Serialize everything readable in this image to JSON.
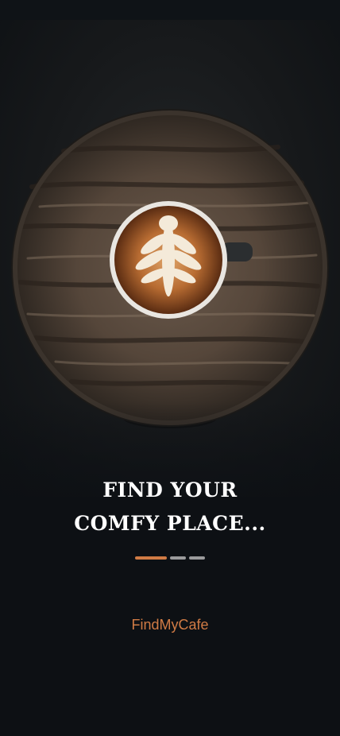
{
  "onboarding": {
    "title_line1": "FIND YOUR",
    "title_line2": "COMFY PLACE...",
    "brand": "FindMyCafe",
    "pager": {
      "total": 3,
      "active_index": 0
    }
  },
  "colors": {
    "accent": "#d07b45",
    "background": "#0d1014",
    "pager_inactive": "#9a9a9c",
    "title": "#ffffff"
  },
  "hero": {
    "subject": "latte-art-coffee-cup-on-wooden-stool"
  }
}
